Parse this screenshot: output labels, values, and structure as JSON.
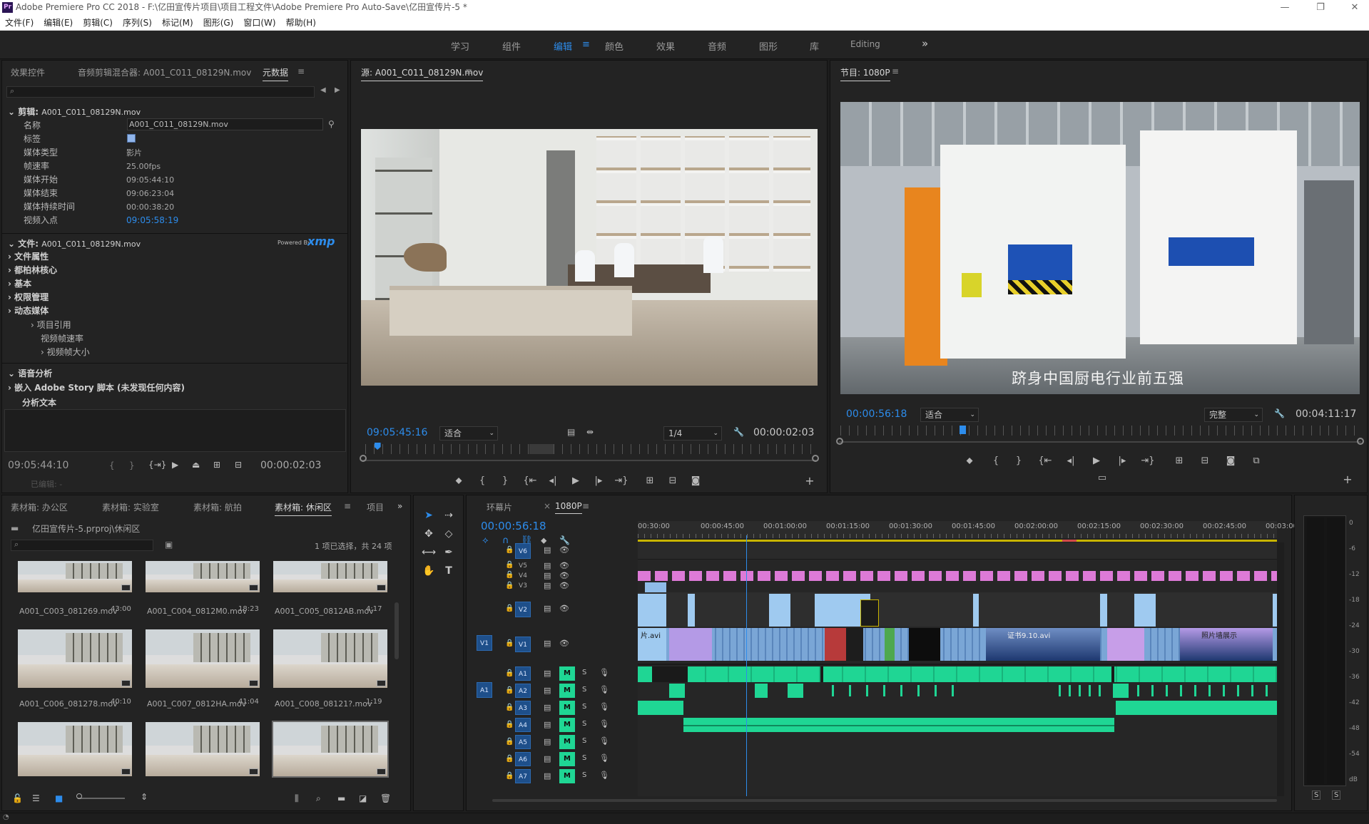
{
  "window": {
    "icon_text": "Pr",
    "title": "Adobe Premiere Pro CC 2018 - F:\\亿田宣传片项目\\项目工程文件\\Adobe Premiere Pro Auto-Save\\亿田宣传片-5 *",
    "minimize": "—",
    "restore": "❐",
    "close": "✕"
  },
  "menu": [
    "文件(F)",
    "编辑(E)",
    "剪辑(C)",
    "序列(S)",
    "标记(M)",
    "图形(G)",
    "窗口(W)",
    "帮助(H)"
  ],
  "workspaces": {
    "items": [
      "学习",
      "组件",
      "编辑",
      "颜色",
      "效果",
      "音频",
      "图形",
      "库",
      "Editing"
    ],
    "active": "编辑",
    "overflow": "»"
  },
  "meta_panel": {
    "tabs": [
      "效果控件",
      "音频剪辑混合器: A001_C011_08129N.mov",
      "元数据"
    ],
    "active_tab": "元数据",
    "clip_section_label": "剪辑",
    "clip_section_value": "A001_C011_08129N.mov",
    "rows": [
      {
        "k": "名称",
        "v": "A001_C011_08129N.mov"
      },
      {
        "k": "标签",
        "v": ""
      },
      {
        "k": "媒体类型",
        "v": "影片"
      },
      {
        "k": "帧速率",
        "v": "25.00fps"
      },
      {
        "k": "媒体开始",
        "v": "09:05:44:10"
      },
      {
        "k": "媒体结束",
        "v": "09:06:23:04"
      },
      {
        "k": "媒体持续时间",
        "v": "00:00:38:20"
      },
      {
        "k": "视频入点",
        "v": "09:05:58:19"
      }
    ],
    "file_section_label": "文件",
    "file_section_value": "A001_C011_08129N.mov",
    "powered_by": "Powered By",
    "xmp": "xmp",
    "file_rows": [
      "文件属性",
      "都柏林核心",
      "基本",
      "权限管理",
      "动态媒体"
    ],
    "sub_rows": [
      "项目引用",
      "视频帧速率",
      "视频帧大小"
    ],
    "speech_label": "语音分析",
    "embed_label": "嵌入 Adobe Story 脚本 (未发现任何内容)",
    "analysis_label": "分析文本",
    "footer_tc": "09:05:44:10",
    "footer_tc_right": "00:00:02:03",
    "edited_label": "已编辑"
  },
  "source_monitor": {
    "title": "源: A001_C011_08129N.mov",
    "timecode": "09:05:45:16",
    "fit": "适合",
    "resolution": "1/4",
    "duration": "00:00:02:03",
    "playhead_fraction": 0.02
  },
  "program_monitor": {
    "title": "节目: 1080P",
    "timecode": "00:00:56:18",
    "fit": "适合",
    "quality": "完整",
    "duration": "00:04:11:17",
    "subtitle": "跻身中国厨电行业前五强",
    "playhead_fraction": 0.23
  },
  "bins": {
    "tabs": [
      "素材箱: 办公区",
      "素材箱: 实验室",
      "素材箱: 航拍",
      "素材箱: 休闲区",
      "项目"
    ],
    "active_tab": "素材箱: 休闲区",
    "path": "亿田宣传片-5.prproj\\休闲区",
    "count": "1 项已选择，共 24 项",
    "items": [
      {
        "name": "A001_C003_081269.mov",
        "dur": "43:00"
      },
      {
        "name": "A001_C004_0812M0.mov",
        "dur": "18:23"
      },
      {
        "name": "A001_C005_0812AB.mov",
        "dur": "4:17"
      },
      {
        "name": "A001_C006_081278.mov",
        "dur": "40:10"
      },
      {
        "name": "A001_C007_0812HA.mov",
        "dur": "41:04"
      },
      {
        "name": "A001_C008_08121?.mov",
        "dur": "1:19"
      },
      {
        "name": "",
        "dur": ""
      },
      {
        "name": "",
        "dur": ""
      },
      {
        "name": "",
        "dur": ""
      }
    ]
  },
  "timeline": {
    "tabs": [
      "环幕片",
      "1080P"
    ],
    "active_tab": "1080P",
    "timecode": "00:00:56:18",
    "ruler": [
      "00:30:00",
      "00:00:45:00",
      "00:01:00:00",
      "00:01:15:00",
      "00:01:30:00",
      "00:01:45:00",
      "00:02:00:00",
      "00:02:15:00",
      "00:02:30:00",
      "00:02:45:00",
      "00:03:00:"
    ],
    "video_tracks": [
      "V6",
      "V5",
      "V4",
      "V3",
      "V2",
      "V1"
    ],
    "audio_tracks": [
      "A1",
      "A2",
      "A3",
      "A4",
      "A5",
      "A6",
      "A7"
    ],
    "source_v": "V1",
    "source_a": "A1",
    "clip_labels": [
      "片.avi",
      "证书9.10.avi",
      "照片墙展示"
    ],
    "playhead_fraction": 0.17
  },
  "meters": {
    "scale": [
      "0",
      "-6",
      "-12",
      "-18",
      "-24",
      "-30",
      "-36",
      "-42",
      "-48",
      "-54",
      "dB"
    ],
    "solo": [
      "S",
      "S"
    ]
  }
}
